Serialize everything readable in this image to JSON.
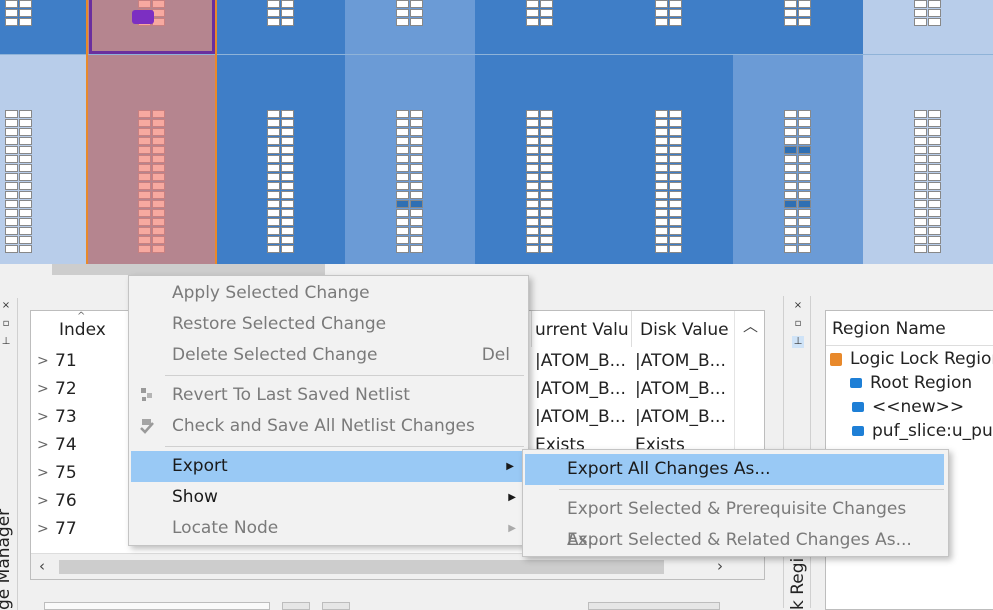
{
  "colors": {
    "floor_light": "#b8cdea",
    "floor_mid": "#6b9bd6",
    "floor_dark": "#3f7ec7",
    "selection_region": "#b5858f",
    "selection_border_orange": "#e8892b",
    "selection_border_purple": "#6a2f9e",
    "menu_highlight": "#99c9f5"
  },
  "table": {
    "headers": {
      "index": "Index",
      "current_value": "urrent Valu",
      "disk_value": "Disk Value"
    },
    "rows": [
      {
        "index": "71",
        "current": "|ATOM_B...",
        "disk": "|ATOM_B..."
      },
      {
        "index": "72",
        "current": "|ATOM_B...",
        "disk": "|ATOM_B..."
      },
      {
        "index": "73",
        "current": "|ATOM_B...",
        "disk": "|ATOM_B..."
      },
      {
        "index": "74",
        "current": "Exists",
        "disk": "Exists"
      },
      {
        "index": "75",
        "current": "",
        "disk": ""
      },
      {
        "index": "76",
        "current": "",
        "disk": ""
      },
      {
        "index": "77",
        "current": "",
        "disk": ""
      }
    ]
  },
  "left_dock_label": "ge Manager",
  "right_dock_label": "k Regio",
  "region_panel": {
    "header": "Region Name",
    "items": [
      {
        "label": "Logic Lock Region",
        "icon": "lock-icon"
      },
      {
        "label": "Root Region",
        "icon": "region-stack-icon"
      },
      {
        "label": "<<new>>",
        "icon": "region-icon"
      },
      {
        "label": "puf_slice:u_puf",
        "icon": "region-icon"
      }
    ]
  },
  "context_menu": {
    "items": [
      {
        "label": "Apply Selected Change",
        "enabled": false
      },
      {
        "label": "Restore Selected Change",
        "enabled": false
      },
      {
        "label": "Delete Selected Change",
        "enabled": false,
        "shortcut": "Del"
      },
      {
        "label": "Revert To Last Saved Netlist",
        "enabled": false,
        "icon": "revert-icon"
      },
      {
        "label": "Check and Save All Netlist Changes",
        "enabled": false,
        "icon": "check-save-icon"
      },
      {
        "label": "Export",
        "enabled": true,
        "highlighted": true,
        "submenu": true
      },
      {
        "label": "Show",
        "enabled": true,
        "submenu": true
      },
      {
        "label": "Locate Node",
        "enabled": false,
        "submenu": true
      }
    ]
  },
  "export_submenu": {
    "items": [
      {
        "label": "Export All Changes As...",
        "enabled": true,
        "highlighted": true
      },
      {
        "label": "Export Selected & Prerequisite Changes As...",
        "enabled": false
      },
      {
        "label": "Export Selected & Related Changes As...",
        "enabled": false
      }
    ]
  }
}
